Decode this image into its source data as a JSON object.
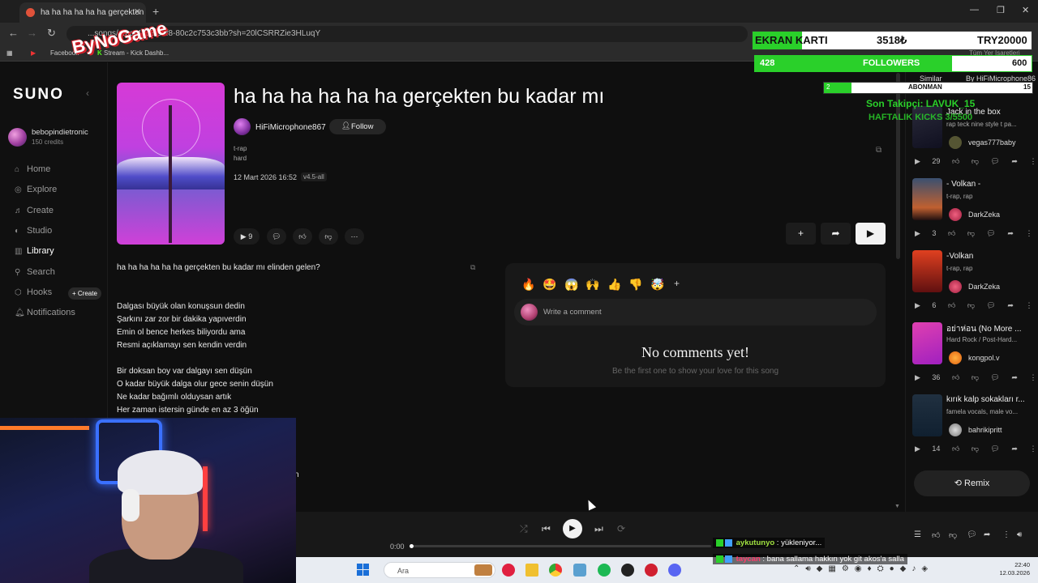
{
  "browser": {
    "tab_title": "ha ha ha ha ha ha gerçekten bu",
    "url": "...songs/...ba-44c8-9ef8-80c2c753c3bb?sh=20lCSRRZie3HLuqY",
    "bookmarks": [
      "Facebook",
      "Stream - Kick Dashb..."
    ],
    "bookmarks_right": "Tüm Yer İşaretleri"
  },
  "sidebar": {
    "logo": "SUNO",
    "username": "bebopindietronic",
    "credits": "150 credits",
    "nav": [
      {
        "label": "Home",
        "icon": "home-icon"
      },
      {
        "label": "Explore",
        "icon": "compass-icon"
      },
      {
        "label": "Create",
        "icon": "music-note-icon"
      },
      {
        "label": "Studio",
        "icon": "studio-icon"
      },
      {
        "label": "Library",
        "icon": "library-icon"
      },
      {
        "label": "Search",
        "icon": "search-icon"
      },
      {
        "label": "Hooks",
        "icon": "hooks-icon"
      },
      {
        "label": "Notifications",
        "icon": "bell-icon"
      }
    ],
    "create_badge": "+ Create"
  },
  "song": {
    "title": "ha ha ha ha ha ha gerçekten bu kadar mı",
    "artist": "HiFiMicrophone867",
    "follow_label": "Follow",
    "tags": [
      "t-rap",
      "hard"
    ],
    "date": "12 Mart 2026 16:52",
    "version": "v4.5-all",
    "play_count": "9"
  },
  "lyrics": [
    "ha ha ha ha ha ha gerçekten bu kadar mı elinden gelen?",
    "",
    "",
    "Dalgası büyük olan konuşsun dedin",
    "Şarkını zar zor bir dakika yapıverdin",
    "Emin ol bence herkes biliyordu ama",
    "Resmi açıklamayı sen kendin verdin",
    "",
    "Bir doksan boy var dalgayı sen düşün",
    "O kadar büyük dalga olur gece senin düşün",
    "Ne kadar bağımlı olduysan artık",
    "Her zaman istersin günde en az  3 öğün"
  ],
  "lyrics_trailing": "n",
  "comments": {
    "placeholder": "Write a comment",
    "empty_title": "No comments yet!",
    "empty_subtitle": "Be the first one to show your love for this song",
    "reactions": [
      "🔥",
      "🤩",
      "😱",
      "🙌",
      "👍",
      "👎",
      "🤯",
      "+"
    ]
  },
  "recommendations": [
    {
      "title": "Jack in the box",
      "tags": "rap teck nine style t pa...",
      "author": "vegas777baby",
      "plays": "29"
    },
    {
      "title": "- Volkan -",
      "tags": "t-rap, rap",
      "author": "DarkZeka",
      "plays": "3"
    },
    {
      "title": "-Volkan",
      "tags": "t-rap, rap",
      "author": "DarkZeka",
      "plays": "6"
    },
    {
      "title": "อย่าห่อน (No More ...",
      "tags": "Hard Rock / Post-Hard...",
      "author": "kongpol.v",
      "plays": "36"
    },
    {
      "title": "kırık kalp sokakları r...",
      "tags": "famela vocals, male vo...",
      "author": "bahrikipritt",
      "plays": "14"
    }
  ],
  "remix_label": "Remix",
  "player": {
    "time": "0:00",
    "progress": 0.0
  },
  "taskbar": {
    "search_label": "Ara",
    "time": "22:40",
    "date": "12.03.2026"
  },
  "overlay": {
    "brand": "ByNoGame",
    "gpu_label": "EKRAN KARTI",
    "gpu_price": "3518₺",
    "gpu_target": "TRY20000",
    "gpu_progress": 0.176,
    "followers_count": "428",
    "followers_label": "FOLLOWERS",
    "followers_target": "600",
    "followers_progress": 0.713,
    "subs_count": "2",
    "subs_label": "ABONMAN",
    "subs_target": "15",
    "subs_progress": 0.133,
    "similar": "Similar",
    "by_line": "By HiFiMicrophone86",
    "last_follower": "Son Takipçi: LAVUK_15",
    "weekly_kicks": "HAFTALIK KICKS 3/5500"
  },
  "chat": [
    {
      "user": "aykutunyo",
      "message": ": yükleniyor..."
    },
    {
      "user": "taycan",
      "message": ": bana sallama hakkın yok git akos'a salla"
    }
  ],
  "colors": {
    "accent_green": "#2ad02a",
    "cover_pink": "#d63ad6"
  }
}
